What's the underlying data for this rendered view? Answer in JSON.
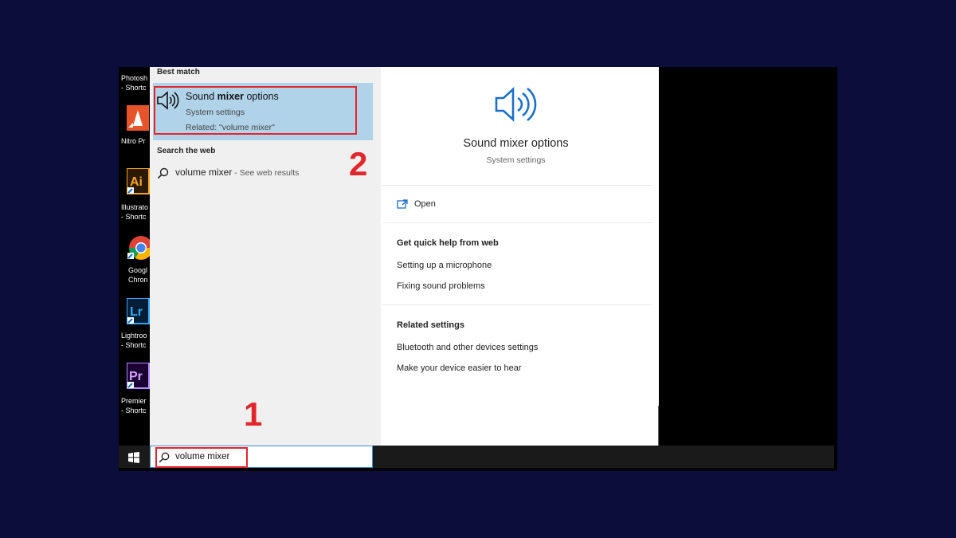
{
  "desktop": {
    "icons": [
      {
        "name": "photoshop-shortcut",
        "line1": "Photosh",
        "line2": "- Shortc"
      },
      {
        "name": "nitro-shortcut",
        "line1": "Nitro Pr",
        "line2": ""
      },
      {
        "name": "illustrator-shortcut",
        "line1": "Illustrato",
        "line2": "- Shortc"
      },
      {
        "name": "chrome-shortcut",
        "line1": "Googl",
        "line2": "Chron"
      },
      {
        "name": "lightroom-shortcut",
        "line1": "Lightroo",
        "line2": "- Shortc"
      },
      {
        "name": "premiere-shortcut",
        "line1": "Premier",
        "line2": "- Shortc"
      }
    ]
  },
  "results": {
    "best_match_header": "Best match",
    "best_match": {
      "title_pre": "Sound ",
      "title_bold": "mixer",
      "title_post": " options",
      "type": "System settings",
      "related": "Related: \"volume mixer\""
    },
    "web_header": "Search the web",
    "web_query": "volume mixer",
    "web_suffix": " - See web results"
  },
  "steps": {
    "one": "1",
    "two": "2"
  },
  "detail": {
    "title": "Sound mixer options",
    "subtitle": "System settings",
    "open_label": "Open",
    "quick_help_header": "Get quick help from web",
    "quick_help_links": [
      "Setting up a microphone",
      "Fixing sound problems"
    ],
    "related_header": "Related settings",
    "related_links": [
      "Bluetooth and other devices settings",
      "Make your device easier to hear"
    ]
  },
  "taskbar": {
    "search_value": "volume mixer"
  },
  "colors": {
    "accent_blue": "#1a6fc9",
    "highlight": "#e3262c",
    "selected_bg": "#b0d3ea",
    "page_bg": "#0b0d3a"
  }
}
